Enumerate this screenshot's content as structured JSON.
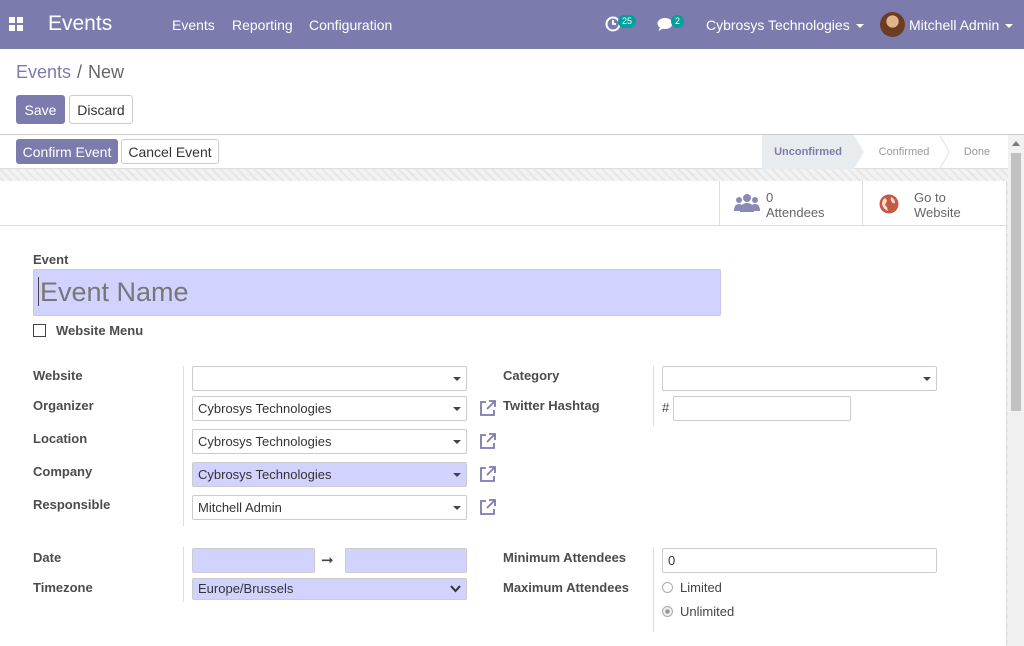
{
  "navbar": {
    "app_name": "Events",
    "menu": [
      "Events",
      "Reporting",
      "Configuration"
    ],
    "activity_count": "25",
    "message_count": "2",
    "company": "Cybrosys Technologies",
    "user": "Mitchell Admin",
    "accent_color": "#7c7bad"
  },
  "breadcrumb": {
    "parent": "Events",
    "separator": "/",
    "current": "New"
  },
  "buttons": {
    "save": "Save",
    "discard": "Discard",
    "confirm_event": "Confirm Event",
    "cancel_event": "Cancel Event"
  },
  "stages": [
    "Unconfirmed",
    "Confirmed",
    "Done"
  ],
  "active_stage": "Unconfirmed",
  "smart_buttons": {
    "attendees": {
      "count": "0",
      "label": "Attendees",
      "icon": "users-icon"
    },
    "website": {
      "line1": "Go to",
      "line2": "Website",
      "icon": "globe-icon"
    }
  },
  "form": {
    "event_label": "Event",
    "event_name_placeholder": "Event Name",
    "website_menu_label": "Website Menu",
    "website_label": "Website",
    "website_value": "",
    "organizer_label": "Organizer",
    "organizer_value": "Cybrosys Technologies",
    "location_label": "Location",
    "location_value": "Cybrosys Technologies",
    "company_label": "Company",
    "company_value": "Cybrosys Technologies",
    "responsible_label": "Responsible",
    "responsible_value": "Mitchell Admin",
    "category_label": "Category",
    "category_value": "",
    "twitter_label": "Twitter Hashtag",
    "hash_symbol": "#",
    "twitter_value": "",
    "date_label": "Date",
    "date_arrow": "➞",
    "timezone_label": "Timezone",
    "timezone_value": "Europe/Brussels",
    "min_attendees_label": "Minimum Attendees",
    "min_attendees_value": "0",
    "max_attendees_label": "Maximum Attendees",
    "max_options": [
      "Limited",
      "Unlimited"
    ],
    "max_selected": "Unlimited"
  }
}
